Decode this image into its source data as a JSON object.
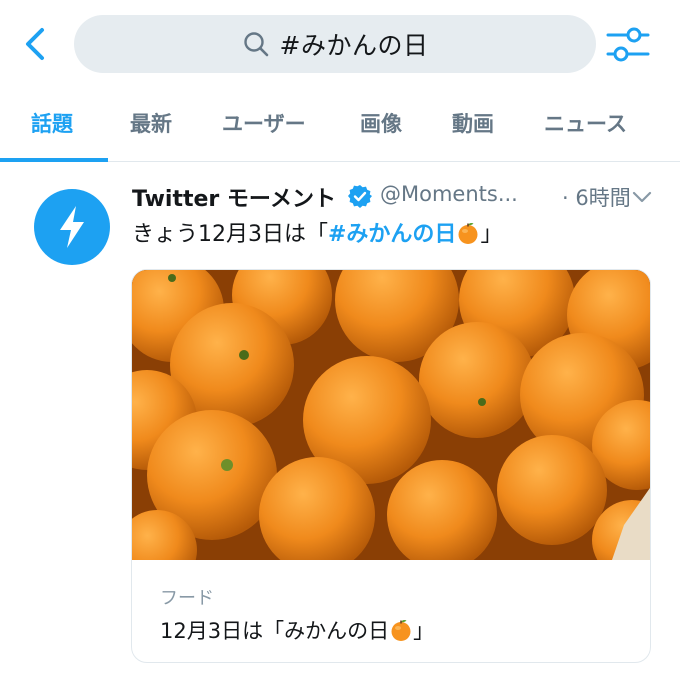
{
  "search": {
    "query": "#みかんの日"
  },
  "icons": {
    "back": "chevron-left-icon",
    "search": "search-icon",
    "filter": "sliders-icon",
    "verified": "verified-badge-icon",
    "more": "chevron-down-icon",
    "moments_logo": "lightning-bolt-icon",
    "emoji": "tangerine-emoji"
  },
  "tabs": [
    {
      "label": "話題",
      "active": true
    },
    {
      "label": "最新",
      "active": false
    },
    {
      "label": "ユーザー",
      "active": false
    },
    {
      "label": "画像",
      "active": false
    },
    {
      "label": "動画",
      "active": false
    },
    {
      "label": "ニュース",
      "active": false
    }
  ],
  "tweet": {
    "name": "Twitter モーメント",
    "handle": "@Moments...",
    "time": "· 6時間",
    "text_prefix": "きょう12月3日は「",
    "hashtag": "#みかんの日",
    "text_suffix": "」",
    "card": {
      "category": "フード",
      "title_prefix": "12月3日は「みかんの日",
      "title_suffix": "」"
    }
  },
  "colors": {
    "accent": "#1da1f2",
    "secondary_text": "#657786",
    "search_bg": "#e6ecf0"
  }
}
